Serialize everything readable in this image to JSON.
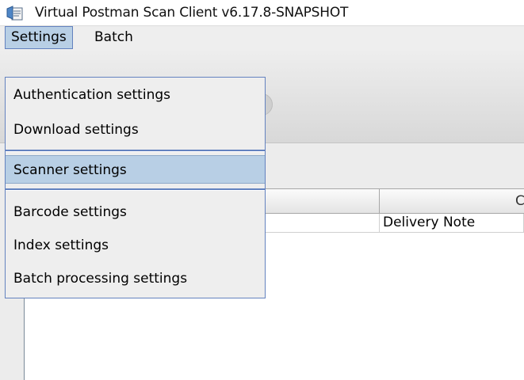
{
  "window": {
    "title": "Virtual Postman Scan Client v6.17.8-SNAPSHOT",
    "icon": "app-icon"
  },
  "menubar": {
    "items": [
      {
        "label": "Settings",
        "active": true
      },
      {
        "label": "Batch",
        "active": false
      }
    ]
  },
  "settings_menu": {
    "items": [
      {
        "label": "Authentication settings"
      },
      {
        "label": "Download settings"
      },
      {
        "label": "Scanner settings",
        "selected": true
      },
      {
        "label": "Barcode settings"
      },
      {
        "label": "Index settings"
      },
      {
        "label": "Batch processing settings"
      }
    ]
  },
  "table": {
    "headers": [
      "",
      "C"
    ],
    "rows": [
      [
        "",
        "Delivery Note"
      ]
    ]
  },
  "colors": {
    "menu_highlight": "#b8cfe5",
    "menu_border": "#6382bf",
    "background": "#eeeeee"
  }
}
